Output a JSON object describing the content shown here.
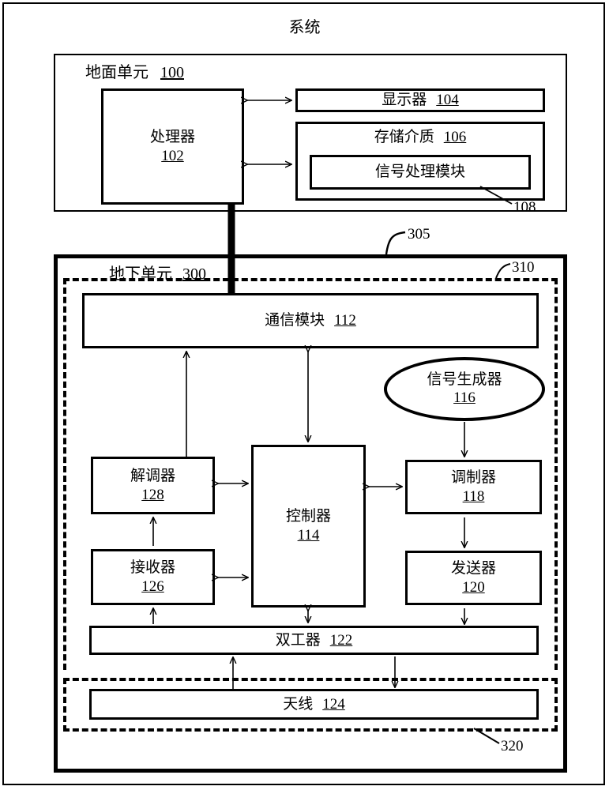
{
  "figure": {
    "title": "系统",
    "ground_unit": {
      "label": "地面单元",
      "ref": "100"
    },
    "underground_unit": {
      "label": "地下单元",
      "ref": "300"
    },
    "callouts": {
      "c305": "305",
      "c310": "310",
      "c320": "320",
      "c108": "108"
    },
    "blocks": {
      "processor": {
        "label": "处理器",
        "ref": "102"
      },
      "display": {
        "label": "显示器",
        "ref": "104"
      },
      "storage": {
        "label": "存储介质",
        "ref": "106"
      },
      "signal_module": {
        "label": "信号处理模块",
        "ref": ""
      },
      "comm_module": {
        "label": "通信模块",
        "ref": "112"
      },
      "signal_gen": {
        "label": "信号生成器",
        "ref": "116"
      },
      "demodulator": {
        "label": "解调器",
        "ref": "128"
      },
      "receiver": {
        "label": "接收器",
        "ref": "126"
      },
      "controller": {
        "label": "控制器",
        "ref": "114"
      },
      "modulator": {
        "label": "调制器",
        "ref": "118"
      },
      "transmitter": {
        "label": "发送器",
        "ref": "120"
      },
      "duplexer": {
        "label": "双工器",
        "ref": "122"
      },
      "antenna": {
        "label": "天线",
        "ref": "124"
      }
    },
    "colors": {
      "stroke": "#000000",
      "background": "#ffffff"
    }
  }
}
